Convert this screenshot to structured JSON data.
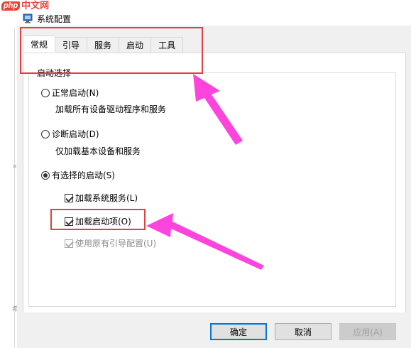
{
  "watermark": {
    "badge": "php",
    "site": "中文网"
  },
  "window": {
    "title": "系统配置"
  },
  "tabs": [
    "常规",
    "引导",
    "服务",
    "启动",
    "工具"
  ],
  "group": {
    "label": "启动选择"
  },
  "options": {
    "normal": {
      "label": "正常启动(N)",
      "desc": "加载所有设备驱动程序和服务",
      "checked": false
    },
    "diagnostic": {
      "label": "诊断启动(D)",
      "desc": "仅加载基本设备和服务",
      "checked": false
    },
    "selective": {
      "label": "有选择的启动(S)",
      "checked": true
    }
  },
  "checks": {
    "system_services": {
      "label": "加载系统服务(L)",
      "checked": true,
      "disabled": false
    },
    "startup_items": {
      "label": "加载启动项(O)",
      "checked": true,
      "disabled": false
    },
    "original_boot": {
      "label": "使用原有引导配置(U)",
      "checked": true,
      "disabled": true
    }
  },
  "buttons": {
    "ok": "确定",
    "cancel": "取消",
    "apply": "应用(A)"
  },
  "colors": {
    "annotation": "#e0403f",
    "arrow": "#ff44dd",
    "focus": "#0078d7"
  },
  "strip": {
    "mark1": "×",
    "mark2": "希"
  }
}
